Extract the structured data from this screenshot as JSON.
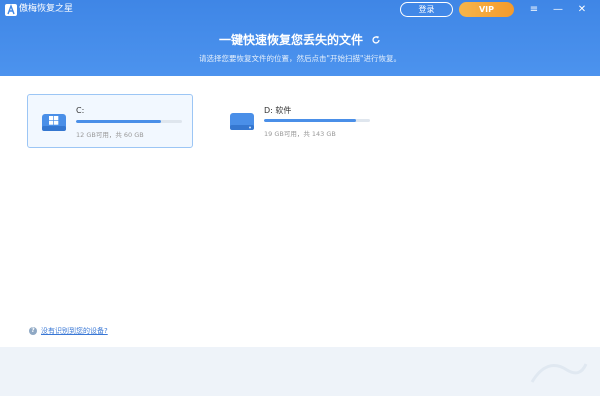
{
  "app": {
    "name": "傲梅恢复之星"
  },
  "titlebar": {
    "login_label": "登录",
    "vip_label": "VIP",
    "menu_glyph": "≡",
    "minimize_glyph": "—",
    "close_glyph": "✕"
  },
  "header": {
    "headline": "一键快速恢复您丢失的文件",
    "subtitle": "请选择您要恢复文件的位置，然后点击\"开始扫描\"进行恢复。"
  },
  "drives": [
    {
      "name": "C:",
      "info": "12 GB可用，共 60 GB",
      "used_fraction": 0.8,
      "selected": true
    },
    {
      "name": "D: 软件",
      "info": "19 GB可用，共 143 GB",
      "used_fraction": 0.87,
      "selected": false
    }
  ],
  "help": {
    "icon_glyph": "?",
    "link_text": "没有识别到您的设备?"
  },
  "colors": {
    "header": "#3f86e6",
    "accent": "#4a8fe8",
    "vip": "#f5a53a",
    "footer": "#eef3f9"
  }
}
